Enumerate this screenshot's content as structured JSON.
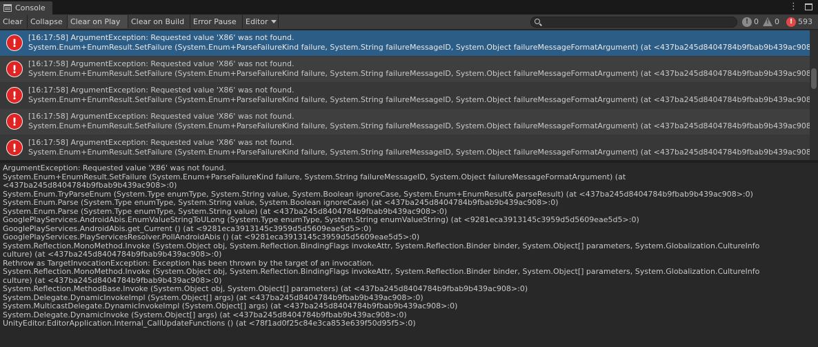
{
  "window": {
    "tab_title": "Console",
    "menu_icon": "kebab-menu-icon",
    "maximize_icon": "maximize-icon"
  },
  "toolbar": {
    "clear": "Clear",
    "collapse": "Collapse",
    "clear_on_play": "Clear on Play",
    "clear_on_build": "Clear on Build",
    "error_pause": "Error Pause",
    "editor": "Editor",
    "search_value": "",
    "info_count": "0",
    "warning_count": "0",
    "error_count": "593"
  },
  "log_entries": [
    {
      "line1": "[16:17:58] ArgumentException: Requested value 'X86' was not found.",
      "line2": "System.Enum+EnumResult.SetFailure (System.Enum+ParseFailureKind failure, System.String failureMessageID, System.Object failureMessageFormatArgument) (at <437ba245d8404784b9fbab9b439ac908>:0)",
      "selected": true
    },
    {
      "line1": "[16:17:58] ArgumentException: Requested value 'X86' was not found.",
      "line2": "System.Enum+EnumResult.SetFailure (System.Enum+ParseFailureKind failure, System.String failureMessageID, System.Object failureMessageFormatArgument) (at <437ba245d8404784b9fbab9b439ac908>:0)",
      "selected": false
    },
    {
      "line1": "[16:17:58] ArgumentException: Requested value 'X86' was not found.",
      "line2": "System.Enum+EnumResult.SetFailure (System.Enum+ParseFailureKind failure, System.String failureMessageID, System.Object failureMessageFormatArgument) (at <437ba245d8404784b9fbab9b439ac908>:0)",
      "selected": false
    },
    {
      "line1": "[16:17:58] ArgumentException: Requested value 'X86' was not found.",
      "line2": "System.Enum+EnumResult.SetFailure (System.Enum+ParseFailureKind failure, System.String failureMessageID, System.Object failureMessageFormatArgument) (at <437ba245d8404784b9fbab9b439ac908>:0)",
      "selected": false
    },
    {
      "line1": "[16:17:58] ArgumentException: Requested value 'X86' was not found.",
      "line2": "System.Enum+EnumResult.SetFailure (System.Enum+ParseFailureKind failure, System.String failureMessageID, System.Object failureMessageFormatArgument) (at <437ba245d8404784b9fbab9b439ac908>:0)",
      "selected": false
    }
  ],
  "detail_lines": [
    "ArgumentException: Requested value 'X86' was not found.",
    "System.Enum+EnumResult.SetFailure (System.Enum+ParseFailureKind failure, System.String failureMessageID, System.Object failureMessageFormatArgument) (at",
    "<437ba245d8404784b9fbab9b439ac908>:0)",
    "System.Enum.TryParseEnum (System.Type enumType, System.String value, System.Boolean ignoreCase, System.Enum+EnumResult& parseResult) (at <437ba245d8404784b9fbab9b439ac908>:0)",
    "System.Enum.Parse (System.Type enumType, System.String value, System.Boolean ignoreCase) (at <437ba245d8404784b9fbab9b439ac908>:0)",
    "System.Enum.Parse (System.Type enumType, System.String value) (at <437ba245d8404784b9fbab9b439ac908>:0)",
    "GooglePlayServices.AndroidAbis.EnumValueStringToULong (System.Type enumType, System.String enumValueString) (at <9281eca3913145c3959d5d5609eae5d5>:0)",
    "GooglePlayServices.AndroidAbis.get_Current () (at <9281eca3913145c3959d5d5609eae5d5>:0)",
    "GooglePlayServices.PlayServicesResolver.PollAndroidAbis () (at <9281eca3913145c3959d5d5609eae5d5>:0)",
    "System.Reflection.MonoMethod.Invoke (System.Object obj, System.Reflection.BindingFlags invokeAttr, System.Reflection.Binder binder, System.Object[] parameters, System.Globalization.CultureInfo",
    "culture) (at <437ba245d8404784b9fbab9b439ac908>:0)",
    "Rethrow as TargetInvocationException: Exception has been thrown by the target of an invocation.",
    "System.Reflection.MonoMethod.Invoke (System.Object obj, System.Reflection.BindingFlags invokeAttr, System.Reflection.Binder binder, System.Object[] parameters, System.Globalization.CultureInfo",
    "culture) (at <437ba245d8404784b9fbab9b439ac908>:0)",
    "System.Reflection.MethodBase.Invoke (System.Object obj, System.Object[] parameters) (at <437ba245d8404784b9fbab9b439ac908>:0)",
    "System.Delegate.DynamicInvokeImpl (System.Object[] args) (at <437ba245d8404784b9fbab9b439ac908>:0)",
    "System.MulticastDelegate.DynamicInvokeImpl (System.Object[] args) (at <437ba245d8404784b9fbab9b439ac908>:0)",
    "System.Delegate.DynamicInvoke (System.Object[] args) (at <437ba245d8404784b9fbab9b439ac908>:0)",
    "UnityEditor.EditorApplication.Internal_CallUpdateFunctions () (at <78f1ad0f25c84e3ca853e639f50d95f5>:0)"
  ],
  "colors": {
    "selection": "#2c5d87",
    "error_red": "#e02424"
  }
}
